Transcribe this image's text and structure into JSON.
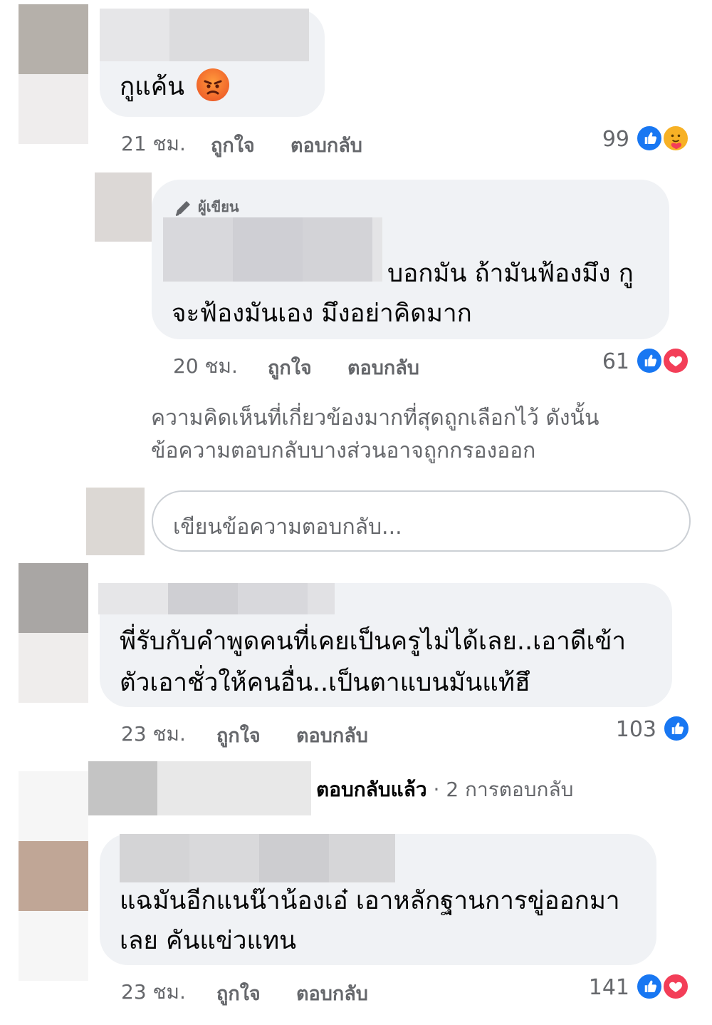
{
  "comments": [
    {
      "text_lines": [
        "กูแค้น"
      ],
      "emoji": "angry-face",
      "time": "21 ชม.",
      "like_label": "ถูกใจ",
      "reply_label": "ตอบกลับ",
      "reaction_count": "99",
      "reactions": [
        "like-icon",
        "care-icon"
      ]
    },
    {
      "author_badge": "ผู้เขียน",
      "text_lines": [
        "บอกมัน ถ้ามันฟ้องมึง กู",
        "จะฟ้องมันเอง มึงอย่าคิดมาก"
      ],
      "time": "20 ชม.",
      "like_label": "ถูกใจ",
      "reply_label": "ตอบกลับ",
      "reaction_count": "61",
      "reactions": [
        "like-icon",
        "love-icon"
      ]
    },
    {
      "text_lines": [
        "พี่รับกับคำพูดคนที่เคยเป็นครูไม่ได้เลย..เอาดีเข้า",
        "ตัวเอาชั่วให้คนอื่น..เป็นตาแบนมันแท้ฮึ"
      ],
      "time": "23 ชม.",
      "like_label": "ถูกใจ",
      "reply_label": "ตอบกลับ",
      "reaction_count": "103",
      "reactions": [
        "like-icon"
      ]
    },
    {
      "text_lines": [
        "แฉมันอีกแนน๊าน้องเอ๋ เอาหลักฐานการขู่ออกมา",
        "เลย คันแข่วแทน"
      ],
      "time": "23 ชม.",
      "like_label": "ถูกใจ",
      "reply_label": "ตอบกลับ",
      "reaction_count": "141",
      "reactions": [
        "like-icon",
        "love-icon"
      ]
    }
  ],
  "filter_note_lines": [
    "ความคิดเห็นที่เกี่ยวข้องมากที่สุดถูกเลือกไว้ ดังนั้น",
    "ข้อความตอบกลับบางส่วนอาจถูกกรองออก"
  ],
  "reply_input": {
    "placeholder": "เขียนข้อความตอบกลับ..."
  },
  "replied_summary": {
    "replied": "ตอบกลับแล้ว",
    "separator": "·",
    "count": "2 การตอบกลับ"
  },
  "colors": {
    "like": "#1877f2",
    "love": "#f33e58",
    "bubble": "#f0f2f5",
    "meta": "#65676b"
  }
}
